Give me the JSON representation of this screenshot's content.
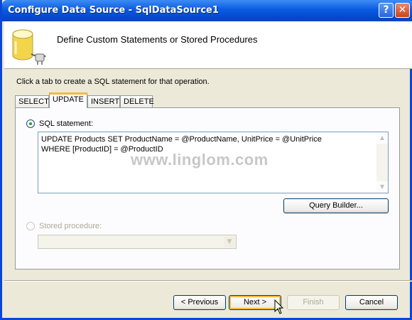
{
  "window": {
    "title": "Configure Data Source - SqlDataSource1",
    "help_icon": "?",
    "close_icon": "✕"
  },
  "header": {
    "title": "Define Custom Statements or Stored Procedures"
  },
  "instruction": "Click a tab to create a SQL statement for that operation.",
  "tabs": [
    {
      "label": "SELECT"
    },
    {
      "label": "UPDATE"
    },
    {
      "label": "INSERT"
    },
    {
      "label": "DELETE"
    }
  ],
  "active_tab": "UPDATE",
  "sql": {
    "radio_label": "SQL statement:",
    "lines": [
      "UPDATE Products SET ProductName = @ProductName, UnitPrice = @UnitPrice",
      "WHERE [ProductID] = @ProductID"
    ],
    "query_builder_label": "Query Builder..."
  },
  "stored_procedure": {
    "radio_label": "Stored procedure:",
    "selected_value": ""
  },
  "buttons": {
    "previous": "< Previous",
    "next": "Next >",
    "finish": "Finish",
    "cancel": "Cancel"
  },
  "watermark": "www.linglom.com",
  "colors": {
    "title_bar": "#0a5be0",
    "dialog_bg": "#ece9d8",
    "tab_highlight": "#f9b83e"
  }
}
